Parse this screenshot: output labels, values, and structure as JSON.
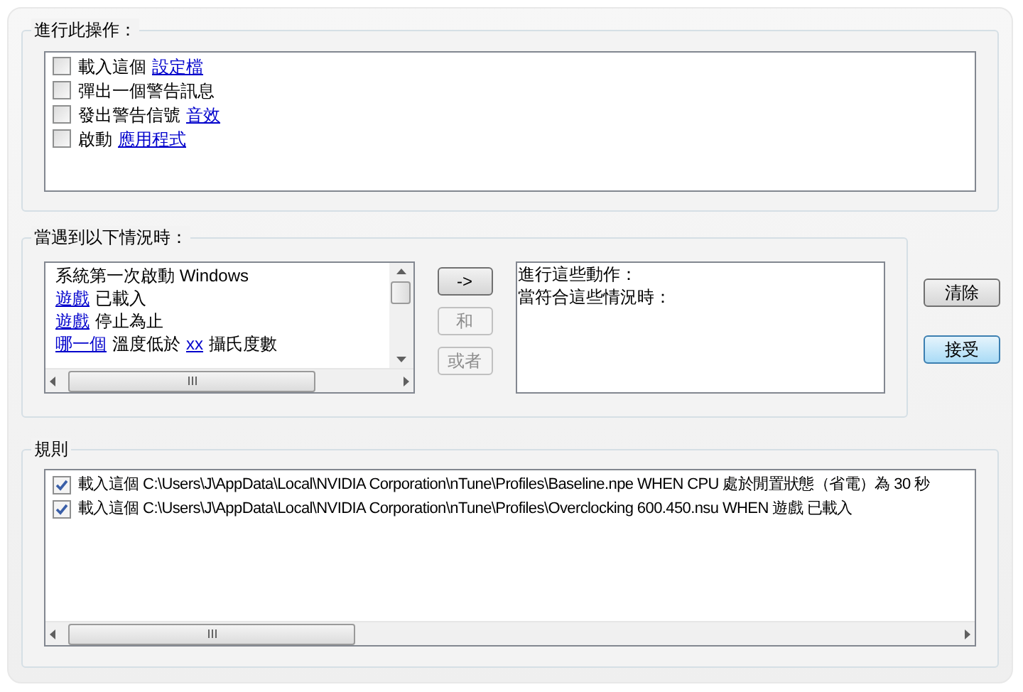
{
  "actions_group": {
    "title": "進行此操作：",
    "items": [
      {
        "checked": false,
        "parts": [
          {
            "kind": "plain",
            "text": "載入這個"
          },
          {
            "kind": "link",
            "text": "設定檔"
          }
        ]
      },
      {
        "checked": false,
        "parts": [
          {
            "kind": "plain",
            "text": "彈出一個警告訊息"
          }
        ]
      },
      {
        "checked": false,
        "parts": [
          {
            "kind": "plain",
            "text": "發出警告信號"
          },
          {
            "kind": "link",
            "text": "音效"
          }
        ]
      },
      {
        "checked": false,
        "parts": [
          {
            "kind": "plain",
            "text": "啟動"
          },
          {
            "kind": "link",
            "text": "應用程式"
          }
        ]
      }
    ]
  },
  "conditions_group": {
    "title": "當遇到以下情況時：",
    "conditions": [
      {
        "parts": [
          {
            "kind": "plain",
            "text": "系統第一次啟動 Windows"
          }
        ]
      },
      {
        "parts": [
          {
            "kind": "link",
            "text": "遊戲"
          },
          {
            "kind": "plain",
            "text": "已載入"
          }
        ]
      },
      {
        "parts": [
          {
            "kind": "link",
            "text": "遊戲"
          },
          {
            "kind": "plain",
            "text": "停止為止"
          }
        ]
      },
      {
        "parts": [
          {
            "kind": "link",
            "text": "哪一個"
          },
          {
            "kind": "plain",
            "text": "溫度低於"
          },
          {
            "kind": "link",
            "text": "xx"
          },
          {
            "kind": "plain",
            "text": "攝氏度數"
          }
        ]
      }
    ],
    "buttons": [
      {
        "label": "->",
        "disabled": false
      },
      {
        "label": "和",
        "disabled": true
      },
      {
        "label": "或者",
        "disabled": true
      }
    ],
    "summary_lines": [
      "進行這些動作：",
      "當符合這些情況時："
    ]
  },
  "side_buttons": [
    {
      "label": "清除",
      "selected": false
    },
    {
      "label": "接受",
      "selected": true
    }
  ],
  "rules_group": {
    "title": "規則",
    "rules": [
      {
        "checked": true,
        "text": "載入這個 C:\\Users\\J\\AppData\\Local\\NVIDIA Corporation\\nTune\\Profiles\\Baseline.npe WHEN CPU 處於閒置狀態（省電）為 30 秒"
      },
      {
        "checked": true,
        "text": "載入這個 C:\\Users\\J\\AppData\\Local\\NVIDIA Corporation\\nTune\\Profiles\\Overclocking 600.450.nsu WHEN 遊戲 已載入"
      }
    ]
  }
}
